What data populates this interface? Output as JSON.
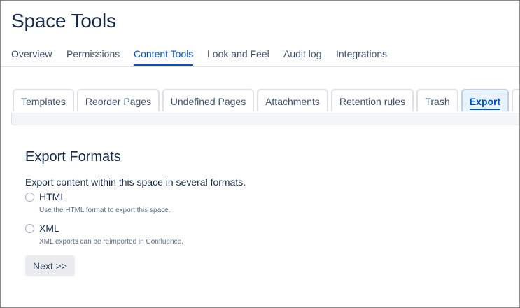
{
  "header": {
    "title": "Space Tools"
  },
  "top_nav": {
    "items": [
      {
        "label": "Overview"
      },
      {
        "label": "Permissions"
      },
      {
        "label": "Content Tools"
      },
      {
        "label": "Look and Feel"
      },
      {
        "label": "Audit log"
      },
      {
        "label": "Integrations"
      }
    ],
    "active": "Content Tools"
  },
  "content_tabs": {
    "items": [
      {
        "label": "Templates"
      },
      {
        "label": "Reorder Pages"
      },
      {
        "label": "Undefined Pages"
      },
      {
        "label": "Attachments"
      },
      {
        "label": "Retention rules"
      },
      {
        "label": "Trash"
      },
      {
        "label": "Export"
      }
    ],
    "active": "Export"
  },
  "export": {
    "heading": "Export Formats",
    "description": "Export content within this space in several formats.",
    "options": [
      {
        "label": "HTML",
        "description": "Use the HTML format to export this space.",
        "selected": false
      },
      {
        "label": "XML",
        "description": "XML exports can be reimported in Confluence.",
        "selected": false
      }
    ],
    "next_label": "Next >>"
  },
  "colors": {
    "accent": "#0052cc",
    "text": "#172b4d",
    "muted": "#42526e"
  }
}
